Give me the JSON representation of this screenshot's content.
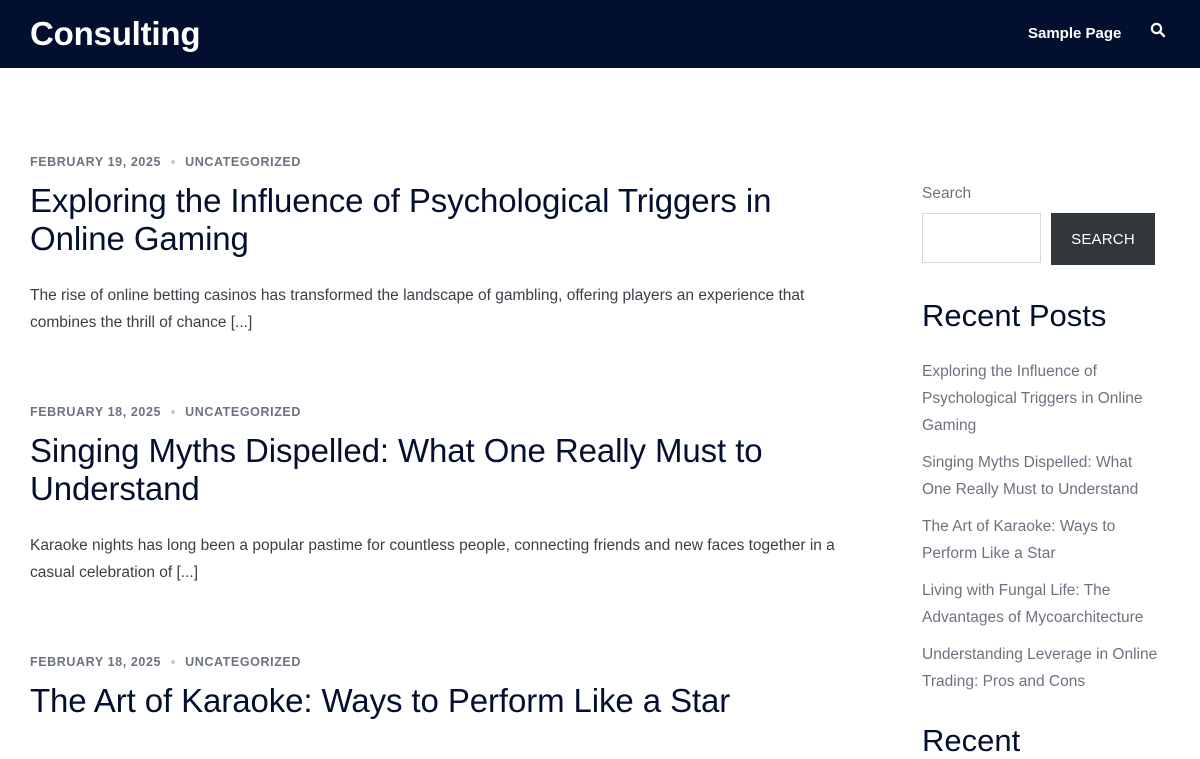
{
  "header": {
    "site_title": "Consulting",
    "nav": [
      {
        "label": "Sample Page"
      }
    ],
    "search_icon": "search-icon"
  },
  "posts": [
    {
      "date": "FEBRUARY 19, 2025",
      "category": "UNCATEGORIZED",
      "title": "Exploring the Influence of Psychological Triggers in Online Gaming",
      "excerpt": "The rise of online betting casinos has transformed the landscape of gambling, offering players an experience that combines the thrill of chance",
      "more": "[...]"
    },
    {
      "date": "FEBRUARY 18, 2025",
      "category": "UNCATEGORIZED",
      "title": "Singing Myths Dispelled: What One Really Must to Understand",
      "excerpt": "Karaoke nights has long been a popular pastime for countless people, connecting friends and new faces together in a casual celebration of",
      "more": "[...]"
    },
    {
      "date": "FEBRUARY 18, 2025",
      "category": "UNCATEGORIZED",
      "title": "The Art of Karaoke: Ways to Perform Like a Star"
    }
  ],
  "sidebar": {
    "search": {
      "label": "Search",
      "placeholder": "",
      "button_label": "SEARCH"
    },
    "recent_posts": {
      "title": "Recent Posts",
      "items": [
        {
          "label": "Exploring the Influence of Psychological Triggers in Online Gaming"
        },
        {
          "label": "Singing Myths Dispelled: What One Really Must to Understand"
        },
        {
          "label": "The Art of Karaoke: Ways to Perform Like a Star"
        },
        {
          "label": "Living with Fungal Life: The Advantages of Mycoarchitecture"
        },
        {
          "label": "Understanding Leverage in Online Trading: Pros and Cons"
        }
      ]
    },
    "next_widget_title": "Recent"
  },
  "colors": {
    "header_bg": "#030f2e",
    "title_text": "#030f2e",
    "meta_text": "#6c7380",
    "button_bg": "#32373c"
  }
}
